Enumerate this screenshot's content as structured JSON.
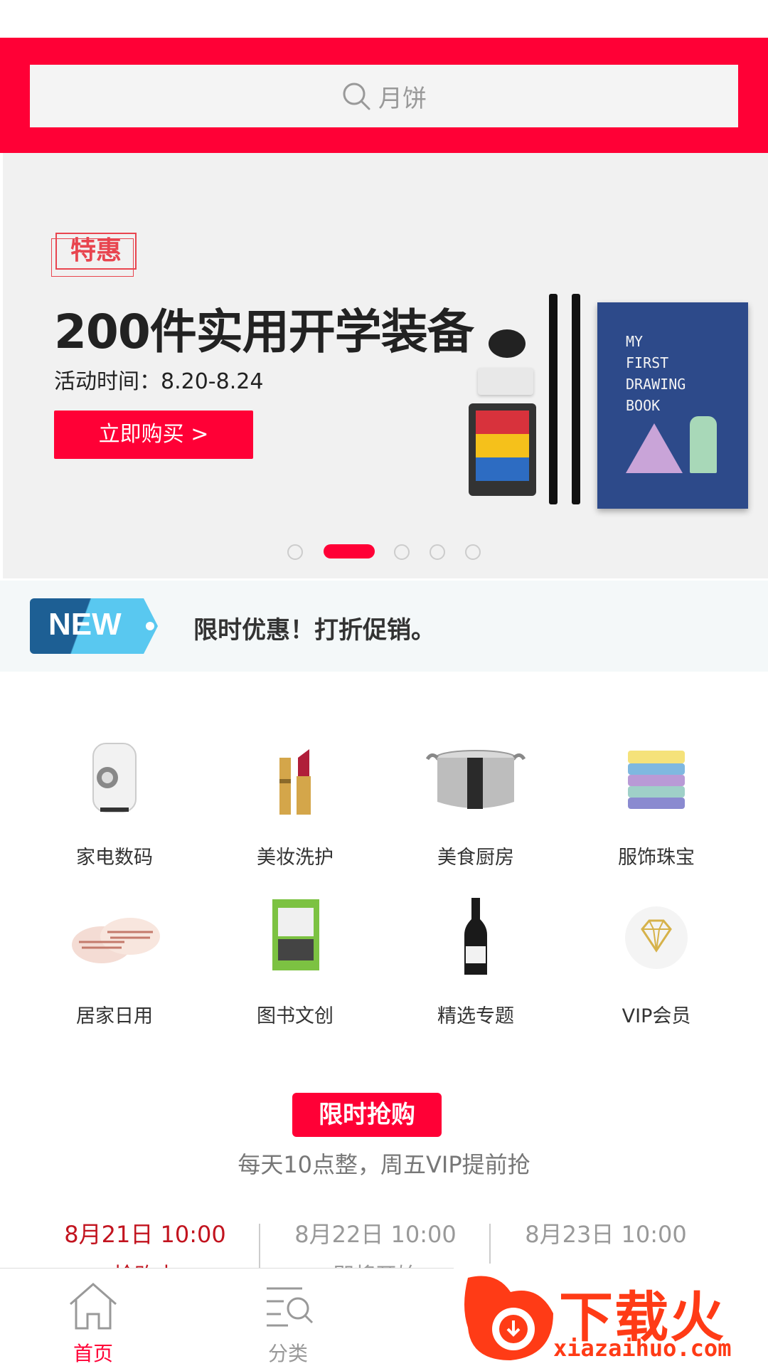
{
  "search": {
    "placeholder": "月饼"
  },
  "banner": {
    "tag": "特惠",
    "title": "200件实用开学装备",
    "time": "活动时间：8.20-8.24",
    "button": "立即购买 >",
    "book_text": [
      "MY",
      "FIRST",
      "DRAWING",
      "BOOK"
    ],
    "pages": 5,
    "current_page": 2
  },
  "news": {
    "badge": "NEW",
    "text": "限时优惠！打折促销。"
  },
  "categories": [
    {
      "label": "家电数码",
      "icon": "appliance-icon"
    },
    {
      "label": "美妆洗护",
      "icon": "lipstick-icon"
    },
    {
      "label": "美食厨房",
      "icon": "cooking-pot-icon"
    },
    {
      "label": "服饰珠宝",
      "icon": "clothing-stack-icon"
    },
    {
      "label": "居家日用",
      "icon": "slippers-icon"
    },
    {
      "label": "图书文创",
      "icon": "book-icon"
    },
    {
      "label": "精选专题",
      "icon": "wine-bottle-icon"
    },
    {
      "label": "VIP会员",
      "icon": "diamond-icon"
    }
  ],
  "flash_sale": {
    "title": "限时抢购",
    "subtitle": "每天10点整，周五VIP提前抢",
    "slots": [
      {
        "time": "8月21日 10:00",
        "status": "抢购中",
        "active": true
      },
      {
        "time": "8月22日 10:00",
        "status": "即将开始",
        "active": false
      },
      {
        "time": "8月23日 10:00",
        "status": "即将开始",
        "active": false
      }
    ]
  },
  "tabbar": {
    "tabs": [
      {
        "label": "首页",
        "icon": "home-icon",
        "active": true
      },
      {
        "label": "分类",
        "icon": "category-search-icon",
        "active": false
      }
    ]
  },
  "watermark": {
    "main": "下载火",
    "url": "xiazaihuo.com"
  },
  "colors": {
    "brand": "#ff0036",
    "active_slot": "#c2141f",
    "news_bg": "#f4f8f9",
    "watermark": "#ff3b16"
  }
}
